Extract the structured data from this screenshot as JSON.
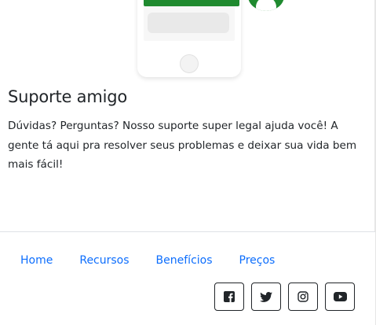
{
  "feature": {
    "title": "Suporte amigo",
    "description": "Dúvidas? Perguntas? Nosso suporte super legal ajuda você! A gente tá aqui pra resolver seus problemas e deixar sua vida bem mais fácil!"
  },
  "footer": {
    "nav": [
      {
        "label": "Home"
      },
      {
        "label": "Recursos"
      },
      {
        "label": "Benefícios"
      },
      {
        "label": "Preços"
      }
    ],
    "social": [
      {
        "icon": "facebook-icon"
      },
      {
        "icon": "twitter-icon"
      },
      {
        "icon": "instagram-icon"
      },
      {
        "icon": "youtube-icon"
      }
    ]
  },
  "colors": {
    "link": "#0d6efd",
    "text": "#212529",
    "accent_green": "#1f8a2f",
    "border": "#dee2e6"
  }
}
